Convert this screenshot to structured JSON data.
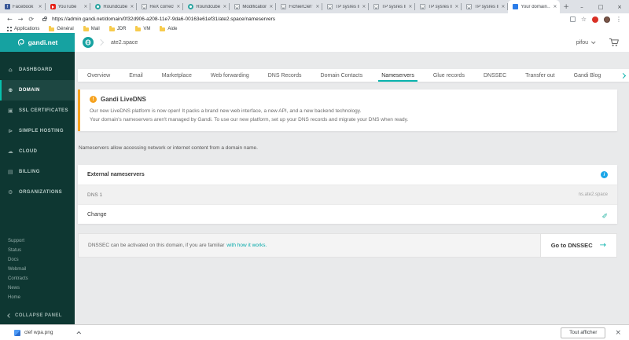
{
  "icons": {
    "back": "←",
    "forward": "→",
    "reload": "⟳",
    "star": "☆",
    "menu": "⋮",
    "minimize": "–",
    "maximize": "□",
    "close": "×",
    "plus": "+",
    "dashboard": "⌂",
    "domain": "⊕",
    "ssl": "▣",
    "hosting": "⊳",
    "cloud": "☁",
    "billing": "▤",
    "organizations": "⚙",
    "alert": "!",
    "info": "i",
    "pencil": "✎",
    "arrow_right": "→",
    "gandi_favicon": "G"
  },
  "browser": {
    "tabs": [
      {
        "label": "Facebook"
      },
      {
        "label": "YouTube"
      },
      {
        "label": "Roundcube W…"
      },
      {
        "label": "ReX correctio…"
      },
      {
        "label": "Roundcube W…"
      },
      {
        "label": "Modification …"
      },
      {
        "label": "FichierClef w…"
      },
      {
        "label": "TP sysres IMA…"
      },
      {
        "label": "TP sysres IMA…"
      },
      {
        "label": "TP sysres IMA…"
      },
      {
        "label": "TP sysres IMA…"
      },
      {
        "label": "Your domain…"
      }
    ],
    "url": "https://admin.gandi.net/domain/0f32d906-a208-11e7-9da6-00163e61ef31/ate2.space/nameservers",
    "bookmarks": [
      "Applications",
      "Général",
      "Mail",
      "JDR",
      "VM",
      "Aide"
    ]
  },
  "app": {
    "logo": "gandi.net",
    "breadcrumb": "ate2.space",
    "user": "pifou",
    "sidebar": {
      "items": [
        "DASHBOARD",
        "DOMAIN",
        "SSL CERTIFICATES",
        "SIMPLE HOSTING",
        "CLOUD",
        "BILLING",
        "ORGANIZATIONS"
      ],
      "links": [
        "Support",
        "Status",
        "Docs",
        "Webmail",
        "Contracts",
        "News",
        "Home"
      ],
      "collapse": "COLLAPSE PANEL"
    },
    "tabs": [
      "Overview",
      "Email",
      "Marketplace",
      "Web forwarding",
      "DNS Records",
      "Domain Contacts",
      "Nameservers",
      "Glue records",
      "DNSSEC",
      "Transfer out",
      "Gandi Blog"
    ],
    "notice": {
      "title": "Gandi LiveDNS",
      "line1": "Our new LiveDNS platform is now open! It packs a brand new web interface, a new API, and a new backend technology.",
      "line2": "Your domain's nameservers aren't managed by Gandi. To use our new platform, set up your DNS records and migrate your DNS when ready."
    },
    "intro": "Nameservers allow accessing network or internet content from a domain name.",
    "nameservers_card": {
      "title": "External nameservers",
      "dns1_label": "DNS 1",
      "dns1_value": "ns.ate2.space",
      "change_label": "Change"
    },
    "dnssec": {
      "text": "DNSSEC can be activated on this domain, if you are familiar",
      "link": "with how it works.",
      "button": "Go to DNSSEC"
    }
  },
  "downloads": {
    "file": "clef wpa.png",
    "show_all": "Tout afficher"
  }
}
